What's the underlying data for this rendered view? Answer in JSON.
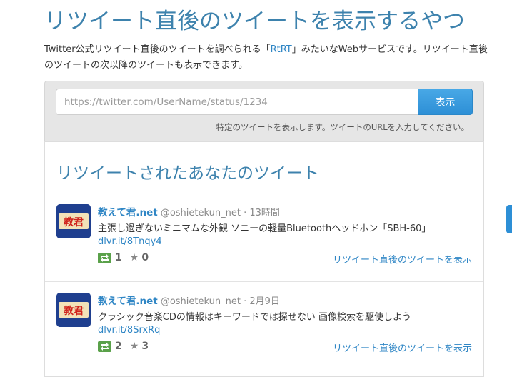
{
  "header": {
    "title": "リツイート直後のツイートを表示するやつ",
    "description_before": "Twitter公式リツイート直後のツイートを調べられる「",
    "description_link": "RtRT",
    "description_after": "」みたいなWebサービスです。リツイート直後のツイートの次以降のツイートも表示できます。"
  },
  "search": {
    "placeholder": "https://twitter.com/UserName/status/1234",
    "button_label": "表示",
    "hint": "特定のツイートを表示します。ツイートのURLを入力してください。"
  },
  "results": {
    "title": "リツイートされたあなたのツイート",
    "tweets": [
      {
        "name": "教えて君.net",
        "handle": "@oshietekun_net",
        "time": "13時間",
        "text": "主張し過ぎないミニマムな外観 ソニーの軽量Bluetoothヘッドホン「SBH-60」",
        "link": "dlvr.it/8Tnqy4",
        "retweets": "1",
        "favorites": "0",
        "action": "リツイート直後のツイートを表示"
      },
      {
        "name": "教えて君.net",
        "handle": "@oshietekun_net",
        "time": "2月9日",
        "text": "クラシック音楽CDの情報はキーワードでは探せない 画像検索を駆使しよう",
        "link": "dlvr.it/8SrxRq",
        "retweets": "2",
        "favorites": "3",
        "action": "リツイート直後のツイートを表示"
      }
    ]
  },
  "separator": " · ",
  "icons": {
    "retweet": "retweet-icon",
    "star": "star-icon"
  },
  "colors": {
    "title": "#3d82ad",
    "link": "#2f86c5",
    "button": "#2d8fd6",
    "retweet": "#5aa14a"
  }
}
